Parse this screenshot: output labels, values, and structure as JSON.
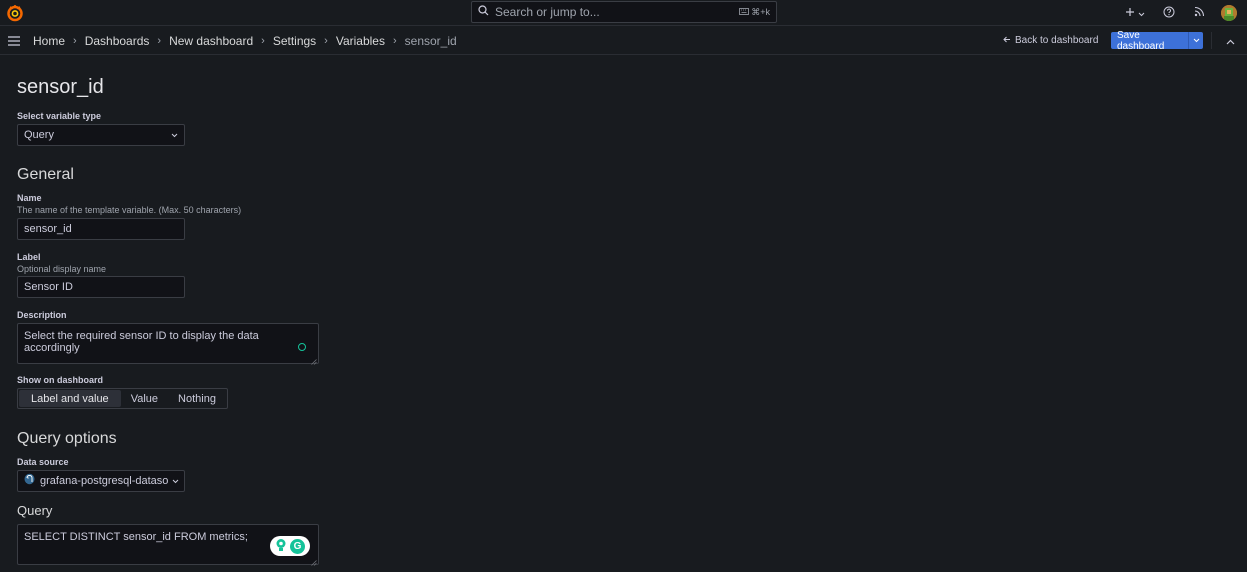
{
  "topbar": {
    "search_placeholder": "Search or jump to...",
    "search_shortcut": "⌘+k"
  },
  "breadcrumb": {
    "items": [
      "Home",
      "Dashboards",
      "New dashboard",
      "Settings",
      "Variables"
    ],
    "current": "sensor_id"
  },
  "actions": {
    "back_label": "Back to dashboard",
    "save_label": "Save dashboard"
  },
  "page": {
    "title": "sensor_id"
  },
  "variable_type": {
    "label": "Select variable type",
    "value": "Query"
  },
  "general": {
    "title": "General",
    "name_label": "Name",
    "name_desc": "The name of the template variable. (Max. 50 characters)",
    "name_value": "sensor_id",
    "label_label": "Label",
    "label_desc": "Optional display name",
    "label_value": "Sensor ID",
    "description_label": "Description",
    "description_value": "Select the required sensor ID to display the data accordingly",
    "show_label": "Show on dashboard",
    "show_options": [
      "Label and value",
      "Value",
      "Nothing"
    ],
    "show_selected": "Label and value"
  },
  "query_options": {
    "title": "Query options",
    "datasource_label": "Data source",
    "datasource_value": "grafana-postgresql-dataso",
    "query_label": "Query",
    "query_value": "SELECT DISTINCT sensor_id FROM metrics;"
  },
  "colors": {
    "background": "#181b1f",
    "primary": "#3d71d9",
    "logo": "#f46800",
    "grammarly": "#15c39a"
  }
}
